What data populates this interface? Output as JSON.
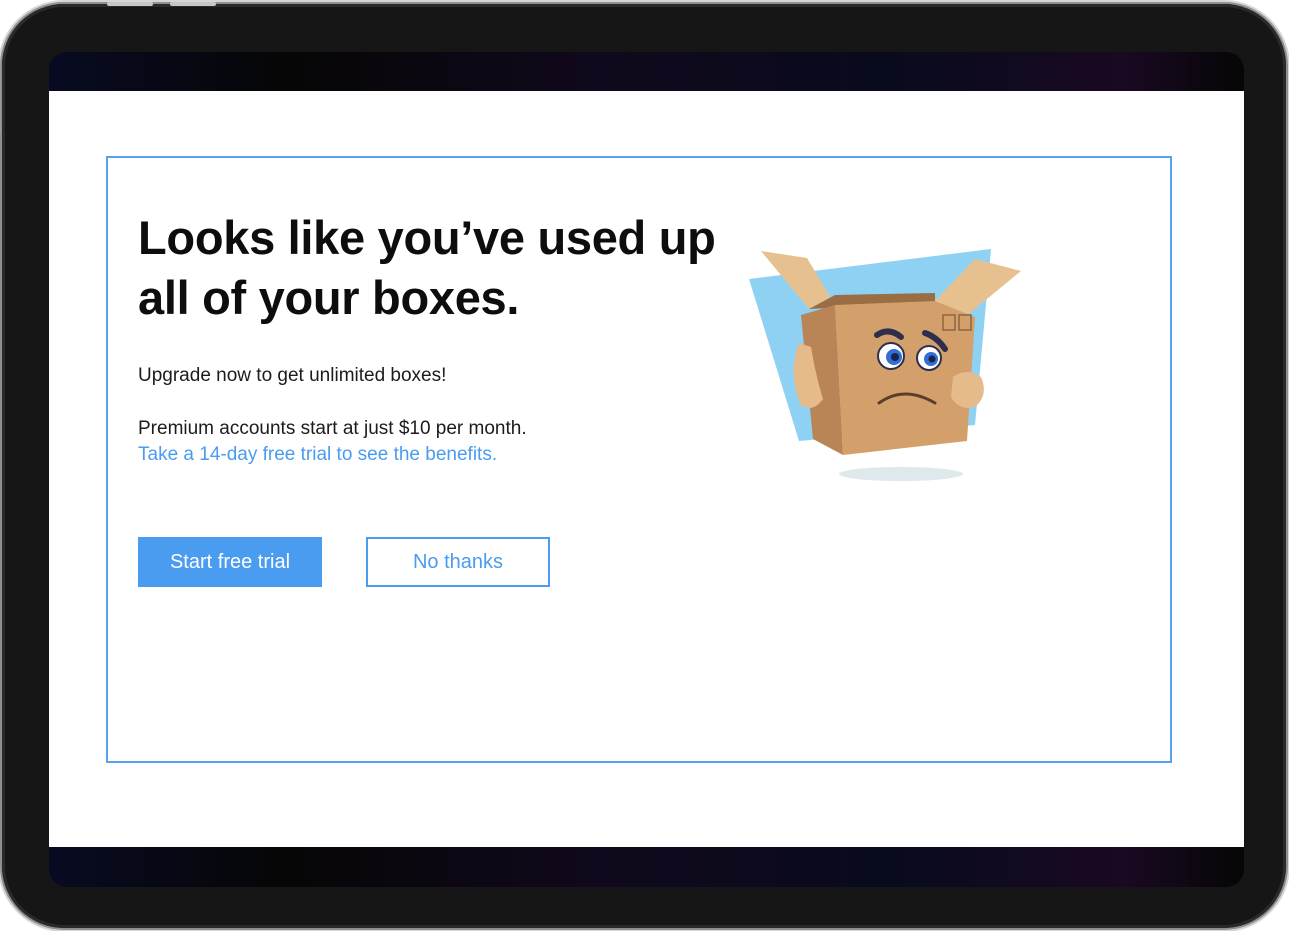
{
  "dialog": {
    "headline": "Looks like you’ve used up all of your boxes.",
    "subtext": "Upgrade now to get unlimited boxes!",
    "price_text": "Premium accounts start at just $10 per month.",
    "trial_link": "Take a 14-day free trial to see the benefits.",
    "primary_button": "Start free trial",
    "secondary_button": "No thanks",
    "illustration": "sad-box-icon"
  },
  "colors": {
    "accent": "#4a9cf0",
    "card_border": "#5aa1ee",
    "text": "#0d0d0d",
    "device_frame": "#161616"
  }
}
